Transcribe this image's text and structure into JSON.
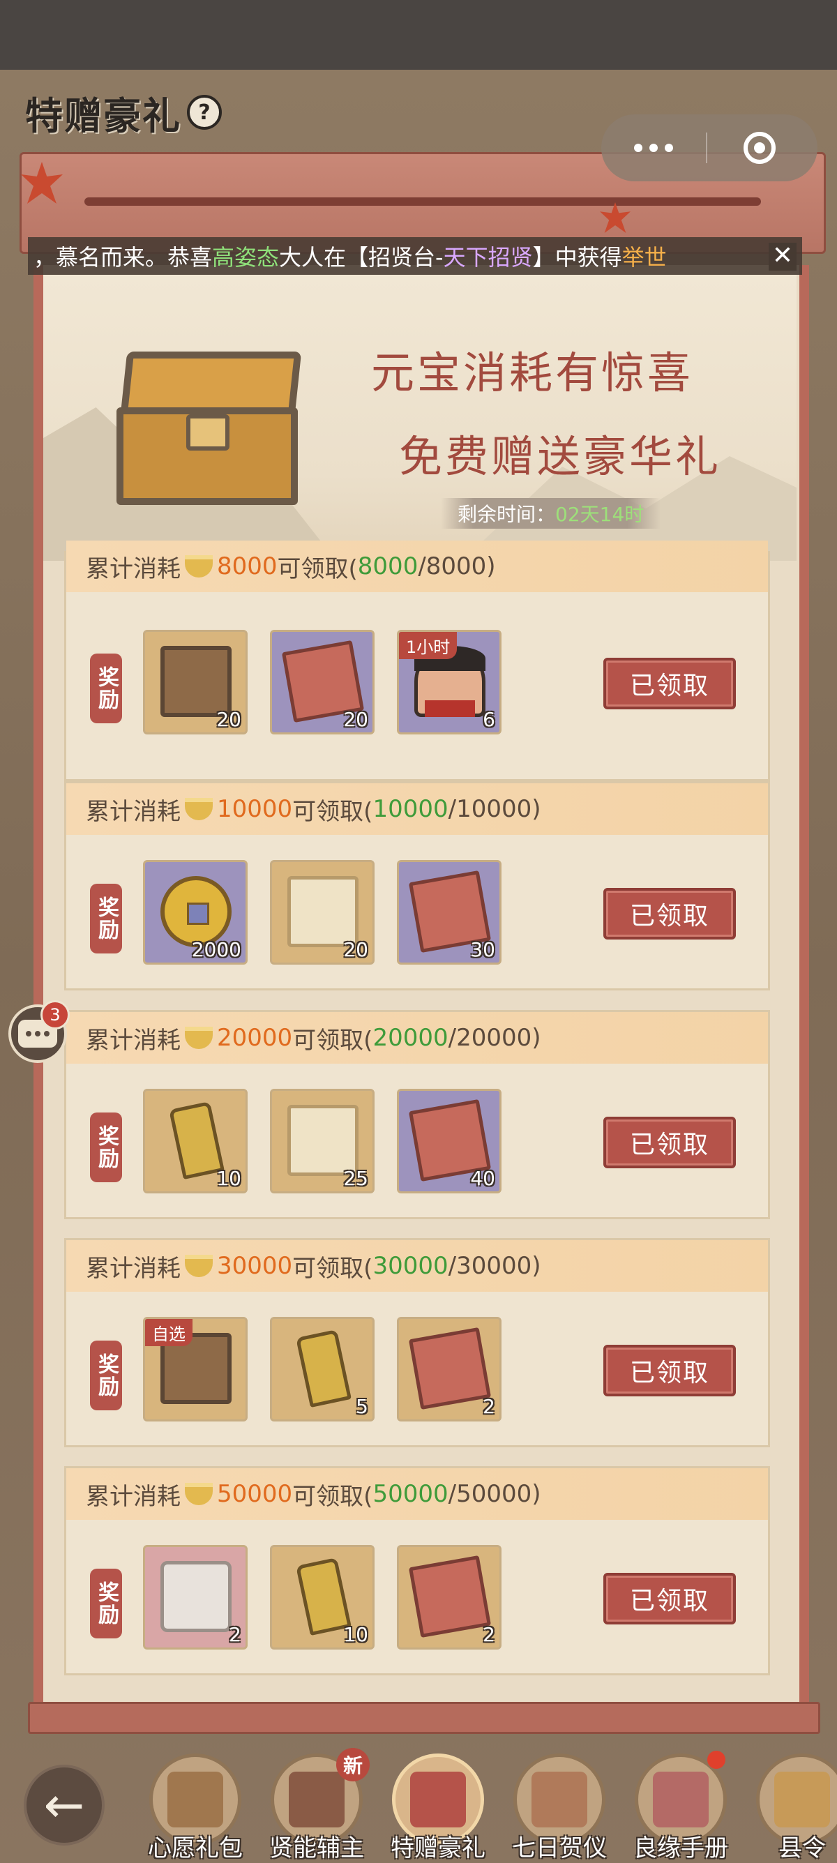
{
  "page": {
    "title": "特赠豪礼",
    "help_label": "?"
  },
  "marquee": {
    "prefix": "，慕名而来。恭喜",
    "player": "高姿态",
    "mid1": "大人在【招贤台-",
    "activity": "天下招贤",
    "mid2": "】中获得",
    "reward": "举世",
    "close_label": "✕"
  },
  "banner": {
    "line1": "元宝消耗有惊喜",
    "line2": "免费赠送豪华礼",
    "timer_label": "剩余时间：",
    "timer_value": "02天14时"
  },
  "cards": [
    {
      "prefix": "累计消耗",
      "target": "8000",
      "mid": "可领取(",
      "progress": "8000",
      "total": "/8000)",
      "tag": "奖励",
      "button": "已领取",
      "items": [
        {
          "icon": "treasure-chest-icon",
          "count": "20",
          "bg": "gold",
          "corner": ""
        },
        {
          "icon": "book-box-icon",
          "count": "20",
          "bg": "purple",
          "corner": ""
        },
        {
          "icon": "official-speedup-icon",
          "count": "6",
          "bg": "purple",
          "corner": "1小时"
        }
      ]
    },
    {
      "prefix": "累计消耗",
      "target": "10000",
      "mid": "可领取(",
      "progress": "10000",
      "total": "/10000)",
      "tag": "奖励",
      "button": "已领取",
      "items": [
        {
          "icon": "copper-coin-icon",
          "count": "2000",
          "bg": "purple",
          "corner": ""
        },
        {
          "icon": "scroll-icon",
          "count": "20",
          "bg": "gold",
          "corner": ""
        },
        {
          "icon": "book-box-icon",
          "count": "30",
          "bg": "purple",
          "corner": ""
        }
      ]
    },
    {
      "prefix": "累计消耗",
      "target": "20000",
      "mid": "可领取(",
      "progress": "20000",
      "total": "/20000)",
      "tag": "奖励",
      "button": "已领取",
      "items": [
        {
          "icon": "gold-token-icon",
          "count": "10",
          "bg": "gold",
          "corner": ""
        },
        {
          "icon": "scroll-icon",
          "count": "25",
          "bg": "gold",
          "corner": ""
        },
        {
          "icon": "book-box-icon",
          "count": "40",
          "bg": "purple",
          "corner": ""
        }
      ]
    },
    {
      "prefix": "累计消耗",
      "target": "30000",
      "mid": "可领取(",
      "progress": "30000",
      "total": "/30000)",
      "tag": "奖励",
      "button": "已领取",
      "items": [
        {
          "icon": "selectable-chest-icon",
          "count": "",
          "bg": "gold",
          "corner": "自选"
        },
        {
          "icon": "gold-token-icon",
          "count": "5",
          "bg": "gold",
          "corner": ""
        },
        {
          "icon": "book-bundle-icon",
          "count": "2",
          "bg": "gold",
          "corner": ""
        }
      ]
    },
    {
      "prefix": "累计消耗",
      "target": "50000",
      "mid": "可领取(",
      "progress": "50000",
      "total": "/50000)",
      "tag": "奖励",
      "button": "已领取",
      "items": [
        {
          "icon": "cauldron-icon",
          "count": "2",
          "bg": "pink",
          "corner": ""
        },
        {
          "icon": "gold-token-icon",
          "count": "10",
          "bg": "gold",
          "corner": ""
        },
        {
          "icon": "book-bundle-icon",
          "count": "2",
          "bg": "gold",
          "corner": ""
        }
      ]
    }
  ],
  "chat": {
    "badge": "3"
  },
  "nav": {
    "back_icon": "←",
    "items": [
      {
        "label": "心愿礼包",
        "badge": "",
        "red_dot": false,
        "active": false
      },
      {
        "label": "贤能辅主",
        "badge": "新",
        "red_dot": false,
        "active": false
      },
      {
        "label": "特赠豪礼",
        "badge": "",
        "red_dot": false,
        "active": true
      },
      {
        "label": "七日贺仪",
        "badge": "",
        "red_dot": false,
        "active": false
      },
      {
        "label": "良缘手册",
        "badge": "",
        "red_dot": true,
        "active": false
      },
      {
        "label": "县令",
        "badge": "",
        "red_dot": false,
        "active": false
      }
    ]
  },
  "colors": {
    "accent_red": "#b5534a",
    "progress_green": "#3f9b3a",
    "target_orange": "#e06a1e",
    "timer_green": "#9de07a"
  }
}
